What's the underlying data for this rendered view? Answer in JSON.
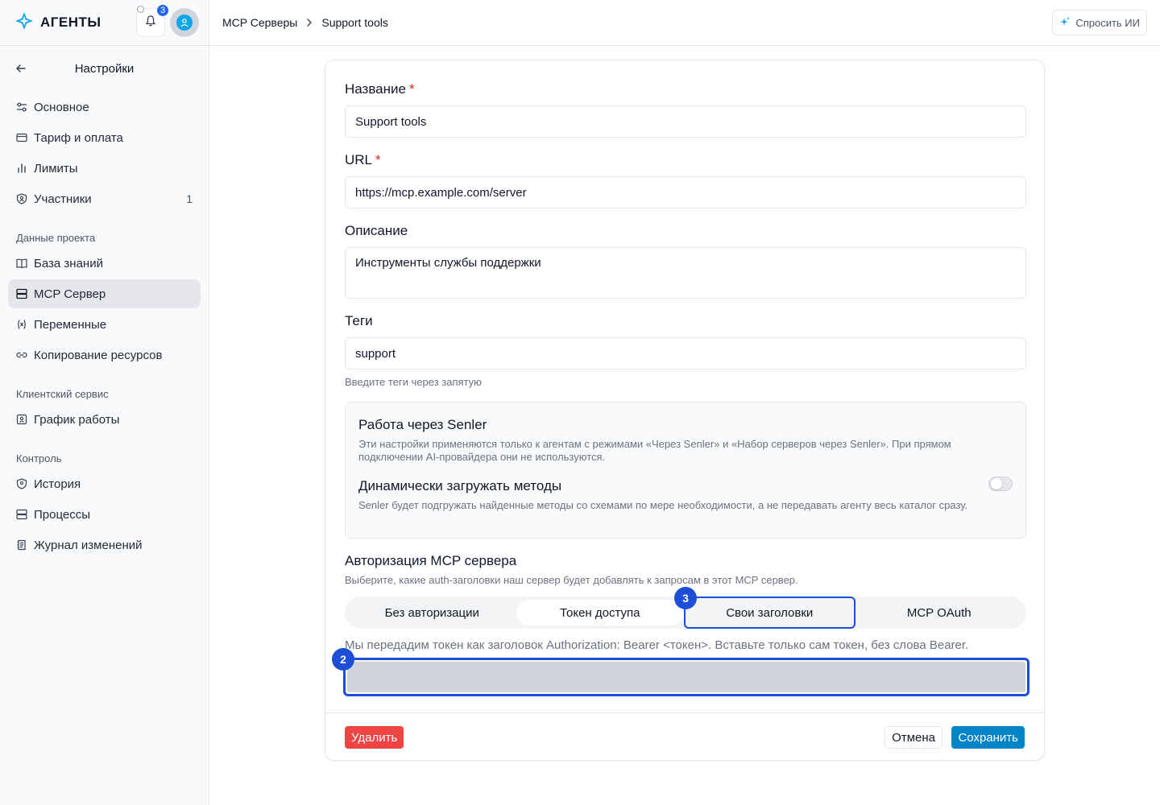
{
  "app": {
    "logo_text": "АГЕНТЫ",
    "notifications_count": "3"
  },
  "breadcrumb": {
    "parent": "MCP Серверы",
    "current": "Support tools"
  },
  "ask_ai": {
    "label": "Спросить ИИ"
  },
  "sidebar": {
    "title": "Настройки",
    "items": [
      {
        "label": "Основное",
        "icon": "sliders-icon"
      },
      {
        "label": "Тариф и оплата",
        "icon": "credit-card-icon"
      },
      {
        "label": "Лимиты",
        "icon": "bar-chart-icon"
      },
      {
        "label": "Участники",
        "icon": "users-icon",
        "count": "1"
      }
    ],
    "group_project": "Данные проекта",
    "project_items": [
      {
        "label": "База знаний",
        "icon": "book-icon"
      },
      {
        "label": "MCP Сервер",
        "icon": "server-icon",
        "active": true
      },
      {
        "label": "Переменные",
        "icon": "variable-icon"
      },
      {
        "label": "Копирование ресурсов",
        "icon": "link-icon"
      }
    ],
    "group_client": "Клиентский сервис",
    "client_items": [
      {
        "label": "График работы",
        "icon": "schedule-icon"
      }
    ],
    "group_control": "Контроль",
    "control_items": [
      {
        "label": "История",
        "icon": "history-icon"
      },
      {
        "label": "Процессы",
        "icon": "server-icon"
      },
      {
        "label": "Журнал изменений",
        "icon": "log-icon"
      }
    ]
  },
  "form": {
    "name_label": "Название",
    "name_value": "Support tools",
    "url_label": "URL",
    "url_value": "https://mcp.example.com/server",
    "description_label": "Описание",
    "description_value": "Инструменты службы поддержки",
    "tags_label": "Теги",
    "tags_value": "support",
    "tags_hint": "Введите теги через запятую",
    "required_mark": "*"
  },
  "senler": {
    "title": "Работа через Senler",
    "description": "Эти настройки применяются только к агентам с режимами «Через Senler» и «Набор серверов через Senler». При прямом подключении AI-провайдера они не используются.",
    "dynamic_title": "Динамически загружать методы",
    "dynamic_description": "Senler будет подгружать найденные методы со схемами по мере необходимости, а не передавать агенту весь каталог сразу.",
    "dynamic_enabled": false
  },
  "auth": {
    "title": "Авторизация MCP сервера",
    "description": "Выберите, какие auth-заголовки наш сервер будет добавлять к запросам в этот MCP сервер.",
    "options": [
      "Без авторизации",
      "Токен доступа",
      "Свои заголовки",
      "MCP OAuth"
    ],
    "selected": "Токен доступа",
    "token_hint": "Мы передадим токен как заголовок Authorization: Bearer <токен>. Вставьте только сам токен, без слова Bearer.",
    "token_value": ""
  },
  "markers": {
    "tab": "3",
    "input": "2"
  },
  "footer": {
    "delete_label": "Удалить",
    "cancel_label": "Отмена",
    "save_label": "Сохранить"
  },
  "colors": {
    "accent": "#1d4ed8",
    "danger": "#ef4444",
    "save": "#0284c7"
  }
}
